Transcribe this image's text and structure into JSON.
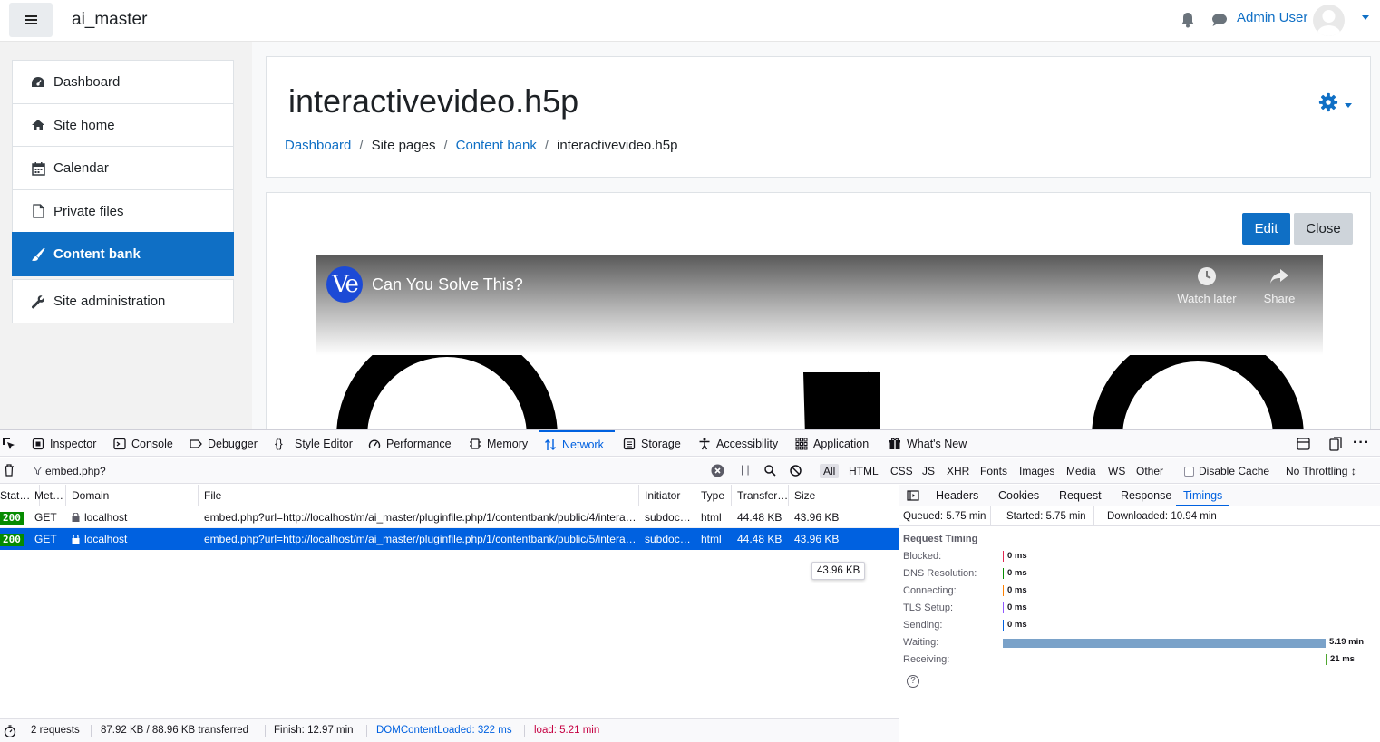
{
  "navbar": {
    "site_name": "ai_master",
    "user_name": "Admin User"
  },
  "nav": {
    "items": [
      {
        "label": "Dashboard",
        "icon": "dashboard-icon"
      },
      {
        "label": "Site home",
        "icon": "home-icon"
      },
      {
        "label": "Calendar",
        "icon": "calendar-icon"
      },
      {
        "label": "Private files",
        "icon": "file-icon"
      },
      {
        "label": "Content bank",
        "icon": "brush-icon",
        "active": true
      },
      {
        "label": "Site administration",
        "icon": "wrench-icon"
      }
    ]
  },
  "header": {
    "title": "interactivevideo.h5p",
    "breadcrumb": [
      "Dashboard",
      "Site pages",
      "Content bank",
      "interactivevideo.h5p"
    ]
  },
  "content": {
    "edit_label": "Edit",
    "close_label": "Close",
    "video": {
      "channel_initials": "Ve",
      "title": "Can You Solve This?",
      "watch_later": "Watch later",
      "share": "Share"
    }
  },
  "devtools": {
    "tabs": [
      "Inspector",
      "Console",
      "Debugger",
      "Style Editor",
      "Performance",
      "Memory",
      "Network",
      "Storage",
      "Accessibility",
      "Application",
      "What's New"
    ],
    "selected_tab": "Network",
    "filter_value": "embed.php?",
    "type_filters": [
      "All",
      "HTML",
      "CSS",
      "JS",
      "XHR",
      "Fonts",
      "Images",
      "Media",
      "WS",
      "Other"
    ],
    "disable_cache": "Disable Cache",
    "throttling": "No Throttling ↕",
    "columns": [
      "Stat…",
      "Met…",
      "Domain",
      "File",
      "Initiator",
      "Type",
      "Transfer…",
      "Size"
    ],
    "requests": [
      {
        "status": "200",
        "method": "GET",
        "domain": "localhost",
        "file": "embed.php?url=http://localhost/m/ai_master/pluginfile.php/1/contentbank/public/4/intera…",
        "initiator": "subdoc…",
        "type": "html",
        "transferred": "44.48 KB",
        "size": "43.96 KB"
      },
      {
        "status": "200",
        "method": "GET",
        "domain": "localhost",
        "file": "embed.php?url=http://localhost/m/ai_master/pluginfile.php/1/contentbank/public/5/intera…",
        "initiator": "subdoc…",
        "type": "html",
        "transferred": "44.48 KB",
        "size": "43.96 KB"
      }
    ],
    "tooltip": "43.96 KB",
    "panel_tabs": [
      "Headers",
      "Cookies",
      "Request",
      "Response",
      "Timings"
    ],
    "selected_panel_tab": "Timings",
    "summary": {
      "queued": "Queued: 5.75 min",
      "started": "Started: 5.75 min",
      "downloaded": "Downloaded: 10.94 min"
    },
    "request_timing_title": "Request Timing",
    "timings": [
      {
        "label": "Blocked:",
        "value": "0 ms",
        "color": "#e22850"
      },
      {
        "label": "DNS Resolution:",
        "value": "0 ms",
        "color": "#058b00"
      },
      {
        "label": "Connecting:",
        "value": "0 ms",
        "color": "#ff8000"
      },
      {
        "label": "TLS Setup:",
        "value": "0 ms",
        "color": "#9059ff"
      },
      {
        "label": "Sending:",
        "value": "0 ms",
        "color": "#0061e0"
      },
      {
        "label": "Waiting:",
        "value": "5.19 min",
        "color": "#7aa2c9"
      },
      {
        "label": "Receiving:",
        "value": "21 ms",
        "color": "#4ea62f"
      }
    ],
    "status_bar": {
      "requests": "2 requests",
      "transferred": "87.92 KB / 88.96 KB transferred",
      "finish": "Finish: 12.97 min",
      "dom_content_loaded": "DOMContentLoaded: 322 ms",
      "load": "load: 5.21 min"
    }
  },
  "colors": {
    "moodle_blue": "#0f6fc5",
    "firefox_blue": "#0061e0",
    "status_ok": "#058b00"
  }
}
